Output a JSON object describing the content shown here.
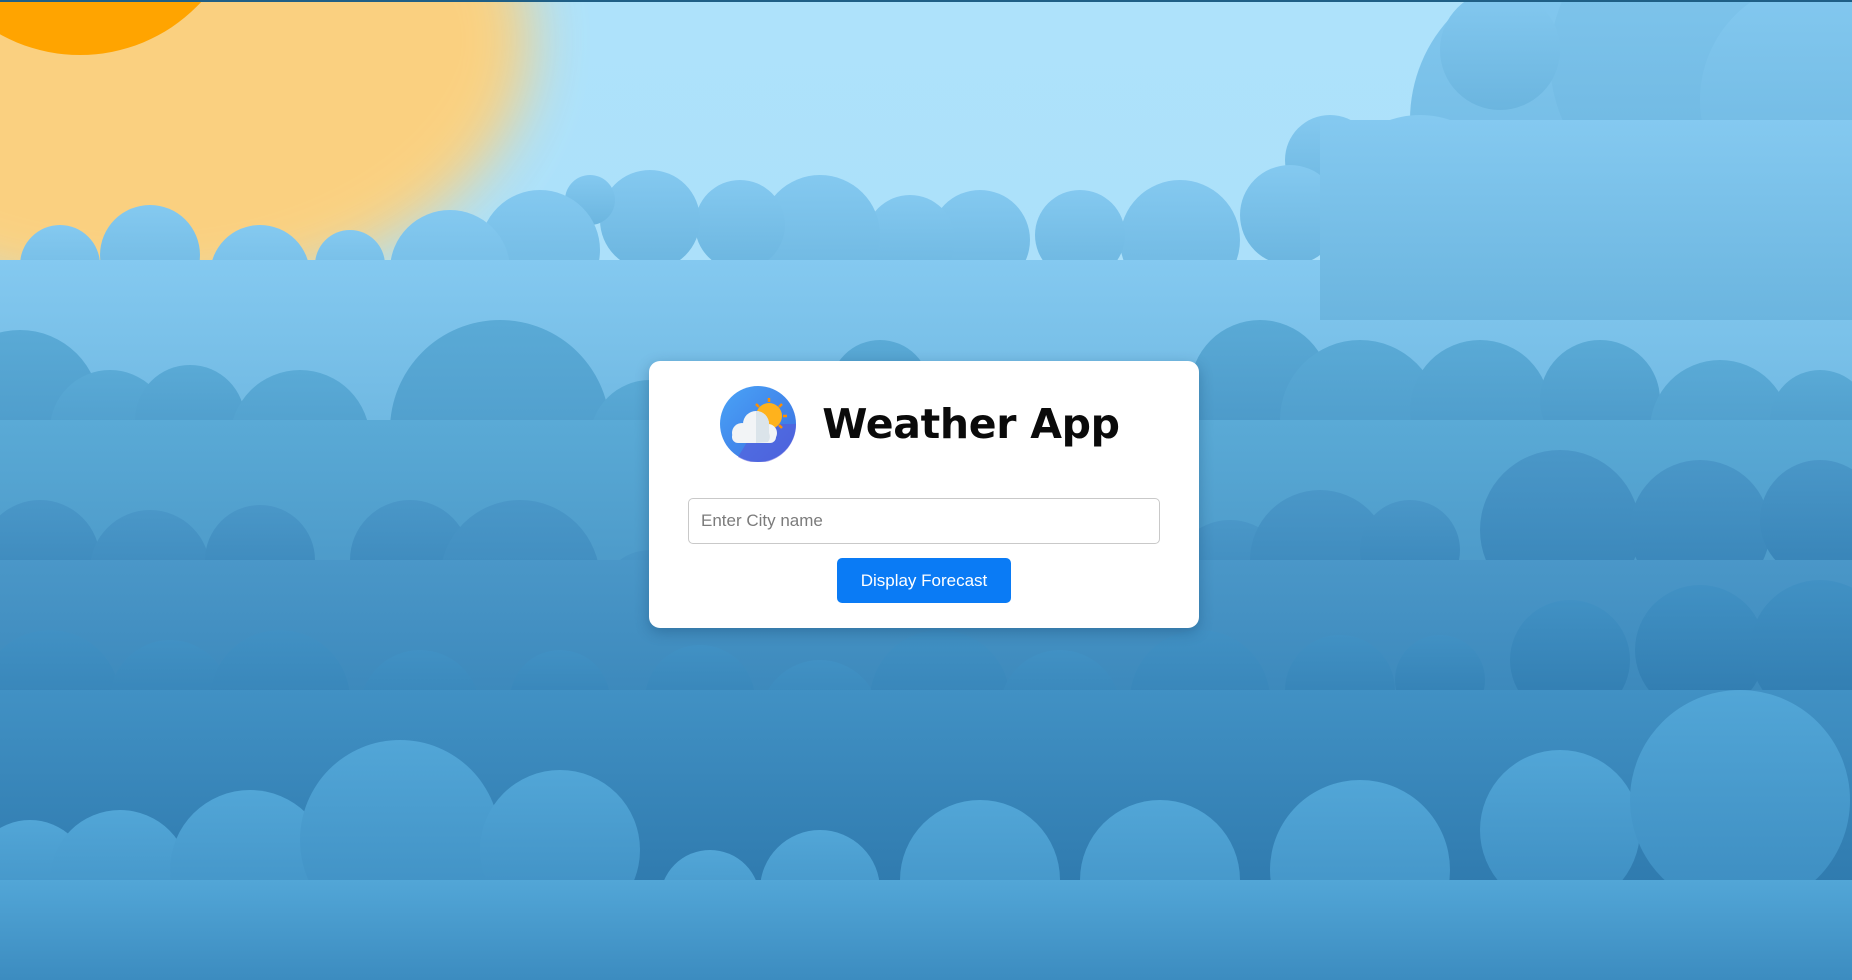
{
  "app": {
    "title": "Weather App",
    "logo_icon": "cloud-sun-icon"
  },
  "search": {
    "placeholder": "Enter City name",
    "value": ""
  },
  "actions": {
    "forecast_label": "Display Forecast"
  },
  "colors": {
    "sky": "#aee2fb",
    "cloud_light": "#7fc4ee",
    "cloud_mid": "#4a9fcf",
    "cloud_dark": "#2e7fb3",
    "sun": "#ffa400",
    "button": "#0a7bf5",
    "card": "#ffffff"
  }
}
